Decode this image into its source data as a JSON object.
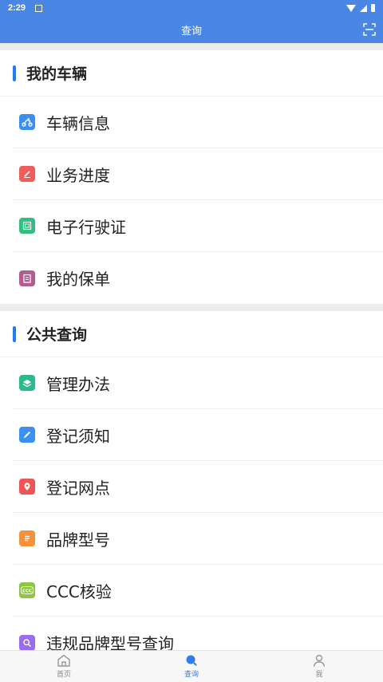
{
  "status_bar": {
    "time": "2:29"
  },
  "header": {
    "title": "查询"
  },
  "sections": [
    {
      "title": "我的车辆",
      "items": [
        {
          "label": "车辆信息",
          "color": "#3b8ff0",
          "icon": "vehicle-icon"
        },
        {
          "label": "业务进度",
          "color": "#f05b5b",
          "icon": "pencil-edit-icon"
        },
        {
          "label": "电子行驶证",
          "color": "#2fbf7f",
          "icon": "license-card-icon"
        },
        {
          "label": "我的保单",
          "color": "#b35c8f",
          "icon": "policy-document-icon"
        }
      ]
    },
    {
      "title": "公共查询",
      "items": [
        {
          "label": "管理办法",
          "color": "#2eb88f",
          "icon": "layers-icon"
        },
        {
          "label": "登记须知",
          "color": "#3c90f0",
          "icon": "edit-note-icon"
        },
        {
          "label": "登记网点",
          "color": "#f05555",
          "icon": "location-pin-icon"
        },
        {
          "label": "品牌型号",
          "color": "#f4913a",
          "icon": "list-document-icon"
        },
        {
          "label": "CCC核验",
          "color": "#8dc63f",
          "icon": "ccc-icon"
        },
        {
          "label": "违规品牌型号查询",
          "color": "#9a6cf0",
          "icon": "search-icon"
        }
      ]
    }
  ],
  "bottom_nav": [
    {
      "label": "首页",
      "icon": "home-icon",
      "active": false
    },
    {
      "label": "查询",
      "icon": "search-icon",
      "active": true
    },
    {
      "label": "我",
      "icon": "user-icon",
      "active": false
    }
  ],
  "colors": {
    "primary": "#4a86e4",
    "accent_bar": "#1e7ef0",
    "active_tab": "#2f7cf0"
  }
}
